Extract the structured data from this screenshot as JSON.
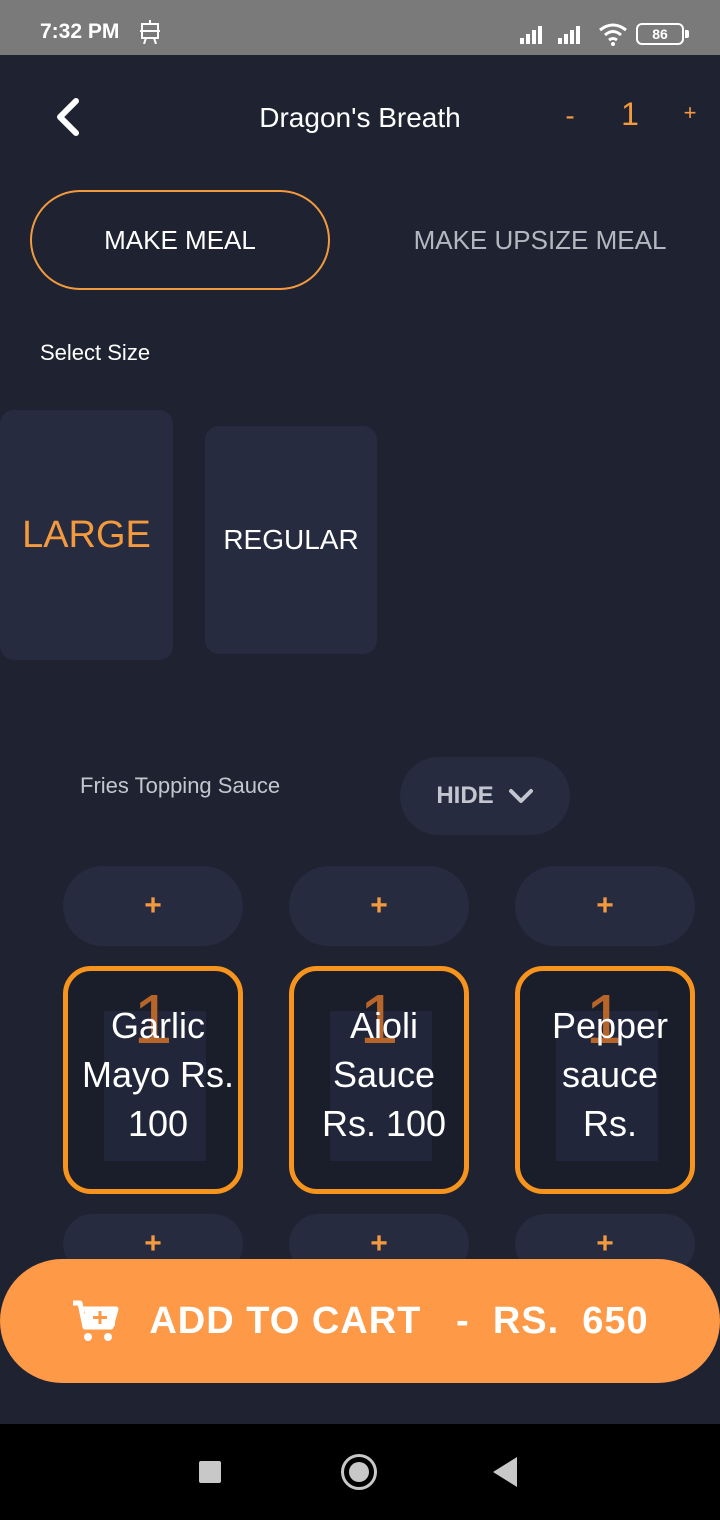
{
  "status_bar": {
    "time": "7:32 PM",
    "battery": "86"
  },
  "header": {
    "title": "Dragon's Breath",
    "qty_minus": "-",
    "qty_value": "1",
    "qty_plus": "+"
  },
  "meal_options": {
    "make_meal": "MAKE MEAL",
    "make_upsize_meal": "MAKE UPSIZE MEAL"
  },
  "size": {
    "label": "Select Size",
    "options": [
      "LARGE",
      "REGULAR"
    ]
  },
  "fries_topping": {
    "label": "Fries Topping Sauce",
    "hide_button": "HIDE",
    "add_symbol": "+",
    "sauces": [
      {
        "count": "1",
        "name": "Garlic Mayo Rs. 100"
      },
      {
        "count": "1",
        "name": "Aioli Sauce Rs. 100"
      },
      {
        "count": "1",
        "name": "Pepper sauce Rs."
      }
    ]
  },
  "add_to_cart": {
    "label": "ADD TO CART   -  RS.  650"
  },
  "colors": {
    "accent": "#f39a3f",
    "cart_button": "#fd9947",
    "background": "#1f2230",
    "card": "#262b40"
  }
}
